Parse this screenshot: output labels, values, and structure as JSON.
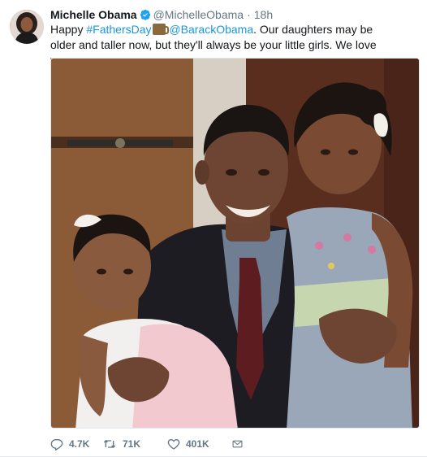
{
  "tweet": {
    "author_name": "Michelle Obama",
    "author_handle": "@MichelleObama",
    "separator": "·",
    "time": "18h",
    "text": {
      "part1": "Happy ",
      "hashtag": "#FathersDay",
      "part2": " ",
      "mention": "@BarackObama",
      "part3": ". Our daughters may be older and taller now, but they'll always be your little girls. We love you."
    },
    "stats": {
      "replies": "4.7K",
      "retweets": "71K",
      "likes": "401K"
    }
  },
  "icons": {
    "verified": "verified-badge-icon",
    "reply": "reply-icon",
    "retweet": "retweet-icon",
    "like": "heart-icon",
    "dm": "envelope-icon",
    "emoji": "mug-emoji-icon"
  },
  "colors": {
    "link": "#1b95e0",
    "meta": "#657786",
    "text": "#14171a",
    "verified": "#1da1f2"
  }
}
